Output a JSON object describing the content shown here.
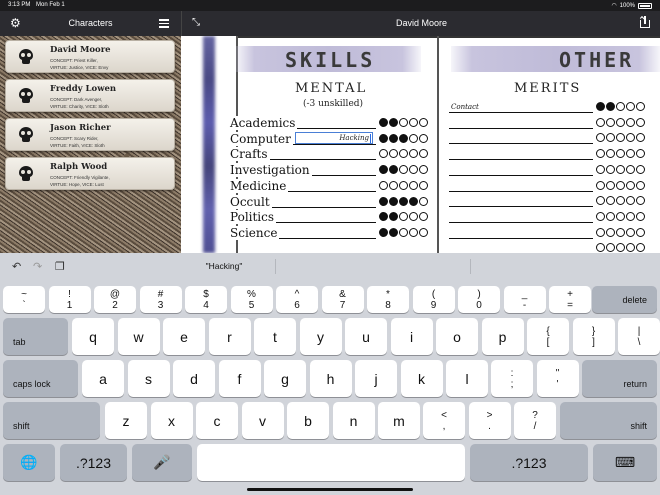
{
  "status_bar": {
    "time": "3:13 PM",
    "date": "Mon Feb 1",
    "battery": "100%"
  },
  "sidebar": {
    "title": "Characters",
    "characters": [
      {
        "name": "David Moore",
        "line1": "CONCEPT: Priest Killer,",
        "line2": "VIRTUE: Justice, VICE: Envy"
      },
      {
        "name": "Freddy Lowen",
        "line1": "CONCEPT: Dark Avenger,",
        "line2": "VIRTUE: Charity, VICE: Sloth"
      },
      {
        "name": "Jason Richer",
        "line1": "CONCEPT: Scary Rider,",
        "line2": "VIRTUE: Faith, VICE: Sloth"
      },
      {
        "name": "Ralph Wood",
        "line1": "CONCEPT: Friendly Vigilante,",
        "line2": "VIRTUE: Hope, VICE: Lust"
      }
    ]
  },
  "main": {
    "title": "David Moore",
    "skills_title": "SKILLS",
    "other_title": "OTHER",
    "mental_heading": "MENTAL",
    "mental_note": "(-3 unskilled)",
    "merits_heading": "MERITS",
    "skills": [
      {
        "name": "Academics",
        "dots": 2
      },
      {
        "name": "Computer",
        "dots": 3,
        "specialty": "Hacking"
      },
      {
        "name": "Crafts",
        "dots": 0
      },
      {
        "name": "Investigation",
        "dots": 2
      },
      {
        "name": "Medicine",
        "dots": 0
      },
      {
        "name": "Occult",
        "dots": 4
      },
      {
        "name": "Politics",
        "dots": 2
      },
      {
        "name": "Science",
        "dots": 2
      }
    ],
    "merits": [
      {
        "name": "Contact",
        "dots": 2
      },
      {
        "name": "",
        "dots": 0
      },
      {
        "name": "",
        "dots": 0
      },
      {
        "name": "",
        "dots": 0
      },
      {
        "name": "",
        "dots": 0
      },
      {
        "name": "",
        "dots": 0
      },
      {
        "name": "",
        "dots": 0
      },
      {
        "name": "",
        "dots": 0
      },
      {
        "name": "",
        "dots": 0
      },
      {
        "name": "",
        "dots": 0
      }
    ]
  },
  "keyboard": {
    "suggestion": "\"Hacking\"",
    "number_row": [
      {
        "top": "~",
        "bottom": "`"
      },
      {
        "top": "!",
        "bottom": "1"
      },
      {
        "top": "@",
        "bottom": "2"
      },
      {
        "top": "#",
        "bottom": "3"
      },
      {
        "top": "$",
        "bottom": "4"
      },
      {
        "top": "%",
        "bottom": "5"
      },
      {
        "top": "^",
        "bottom": "6"
      },
      {
        "top": "&",
        "bottom": "7"
      },
      {
        "top": "*",
        "bottom": "8"
      },
      {
        "top": "(",
        "bottom": "9"
      },
      {
        "top": ")",
        "bottom": "0"
      },
      {
        "top": "_",
        "bottom": "-"
      },
      {
        "top": "+",
        "bottom": "="
      }
    ],
    "delete": "delete",
    "tab": "tab",
    "row_q": [
      "q",
      "w",
      "e",
      "r",
      "t",
      "y",
      "u",
      "i",
      "o",
      "p"
    ],
    "row_q_extra": [
      {
        "top": "{",
        "bottom": "["
      },
      {
        "top": "}",
        "bottom": "]"
      },
      {
        "top": "|",
        "bottom": "\\"
      }
    ],
    "caps_lock": "caps lock",
    "row_a": [
      "a",
      "s",
      "d",
      "f",
      "g",
      "h",
      "j",
      "k",
      "l"
    ],
    "row_a_extra": [
      {
        "top": ":",
        "bottom": ";"
      },
      {
        "top": "\"",
        "bottom": "'"
      }
    ],
    "return": "return",
    "shift": "shift",
    "row_z": [
      "z",
      "x",
      "c",
      "v",
      "b",
      "n",
      "m"
    ],
    "row_z_extra": [
      {
        "top": "<",
        "bottom": ","
      },
      {
        "top": ">",
        "bottom": "."
      },
      {
        "top": "?",
        "bottom": "/"
      }
    ],
    "numbers_key": ".?123"
  }
}
